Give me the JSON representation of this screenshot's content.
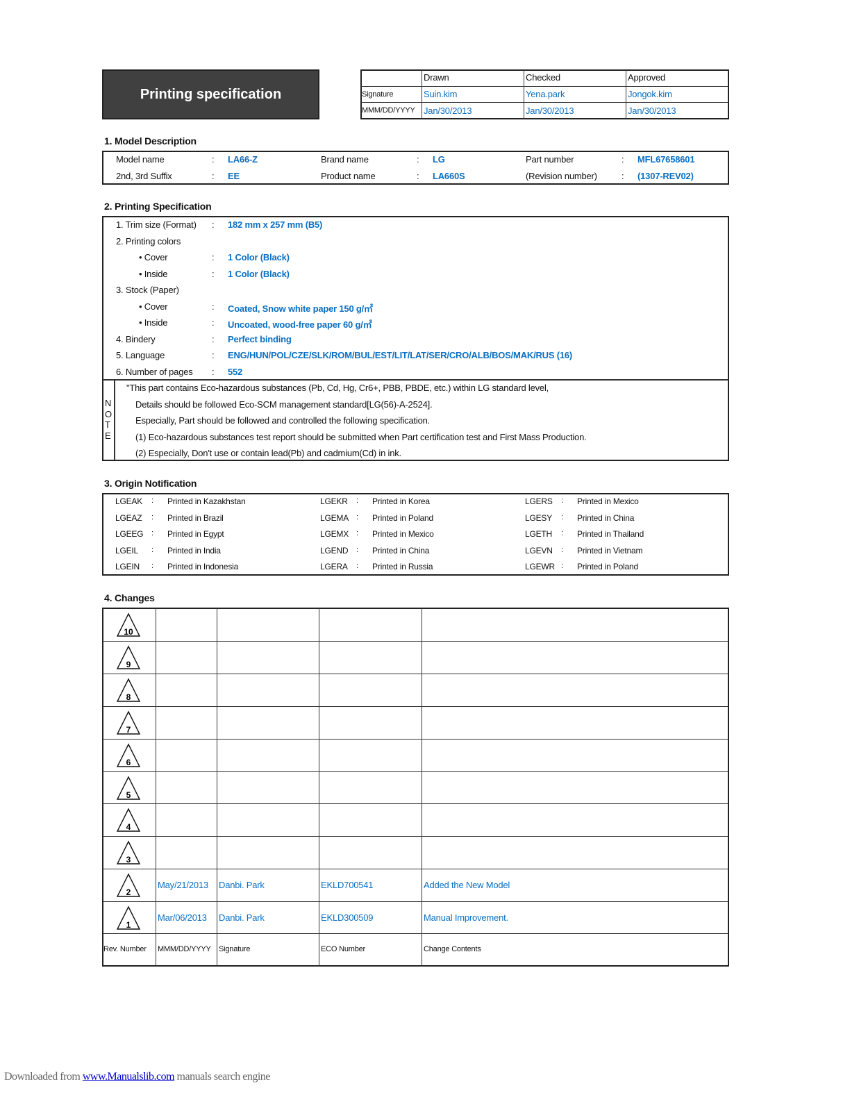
{
  "title": "Printing specification",
  "approval": {
    "headers": [
      "Drawn",
      "Checked",
      "Approved"
    ],
    "row_labels": [
      "Signature",
      "MMM/DD/YYYY"
    ],
    "signatures": [
      "Suin.kim",
      "Yena.park",
      "Jongok.kim"
    ],
    "dates": [
      "Jan/30/2013",
      "Jan/30/2013",
      "Jan/30/2013"
    ]
  },
  "model": {
    "heading": "1. Model Description",
    "colon": ":",
    "fields": [
      {
        "label": "Model name",
        "value": "LA66-Z"
      },
      {
        "label": "Brand name",
        "value": "LG"
      },
      {
        "label": "Part number",
        "value": "MFL67658601"
      },
      {
        "label": "2nd, 3rd Suffix",
        "value": "EE"
      },
      {
        "label": "Product name",
        "value": "LA660S"
      },
      {
        "label": "(Revision number)",
        "value": "(1307-REV02)"
      }
    ]
  },
  "spec": {
    "heading": "2. Printing Specification",
    "items": [
      {
        "label": "1. Trim size (Format)",
        "value": "182 mm x 257 mm (B5)",
        "indent": 0
      },
      {
        "label": "2. Printing colors",
        "value": "",
        "indent": 0
      },
      {
        "label": "• Cover",
        "value": "1 Color (Black)",
        "indent": 1
      },
      {
        "label": "• Inside",
        "value": "1 Color (Black)",
        "indent": 1
      },
      {
        "label": "3. Stock (Paper)",
        "value": "",
        "indent": 0
      },
      {
        "label": "• Cover",
        "value": "Coated, Snow white paper 150 g/㎡",
        "indent": 1
      },
      {
        "label": "• Inside",
        "value": "Uncoated, wood-free paper 60 g/㎡",
        "indent": 1
      },
      {
        "label": "4. Bindery",
        "value": "Perfect binding",
        "indent": 0
      },
      {
        "label": "5. Language",
        "value": "ENG/HUN/POL/CZE/SLK/ROM/BUL/EST/LIT/LAT/SER/CRO/ALB/BOS/MAK/RUS (16)",
        "indent": 0
      },
      {
        "label": "6. Number of pages",
        "value": "552",
        "indent": 0
      }
    ],
    "note_label": [
      "N",
      "O",
      "T",
      "E"
    ],
    "note_lines": [
      "\"This part contains Eco-hazardous substances (Pb, Cd, Hg, Cr6+, PBB, PBDE, etc.) within LG standard level,",
      "Details should be followed Eco-SCM management standard[LG(56)-A-2524].",
      "Especially, Part should be followed and controlled the following specification.",
      "(1) Eco-hazardous substances test report should be submitted when Part certification test and First Mass Production.",
      "(2) Especially, Don't use or contain lead(Pb) and cadmium(Cd) in ink."
    ]
  },
  "origin": {
    "heading": "3. Origin Notification",
    "columns": [
      [
        [
          "LGEAK",
          "Printed in Kazakhstan"
        ],
        [
          "LGEAZ",
          "Printed in Brazil"
        ],
        [
          "LGEEG",
          "Printed in Egypt"
        ],
        [
          "LGEIL",
          "Printed in India"
        ],
        [
          "LGEIN",
          "Printed in Indonesia"
        ]
      ],
      [
        [
          "LGEKR",
          "Printed in Korea"
        ],
        [
          "LGEMA",
          "Printed in Poland"
        ],
        [
          "LGEMX",
          "Printed in Mexico"
        ],
        [
          "LGEND",
          "Printed in China"
        ],
        [
          "LGERA",
          "Printed in Russia"
        ]
      ],
      [
        [
          "LGERS",
          "Printed in Mexico"
        ],
        [
          "LGESY",
          "Printed in China"
        ],
        [
          "LGETH",
          "Printed in Thailand"
        ],
        [
          "LGEVN",
          "Printed in Vietnam"
        ],
        [
          "LGEWR",
          "Printed in Poland"
        ]
      ]
    ]
  },
  "changes": {
    "heading": "4. Changes",
    "rows": [
      {
        "rev": "10",
        "date": "",
        "sig": "",
        "eco": "",
        "content": ""
      },
      {
        "rev": "9",
        "date": "",
        "sig": "",
        "eco": "",
        "content": ""
      },
      {
        "rev": "8",
        "date": "",
        "sig": "",
        "eco": "",
        "content": ""
      },
      {
        "rev": "7",
        "date": "",
        "sig": "",
        "eco": "",
        "content": ""
      },
      {
        "rev": "6",
        "date": "",
        "sig": "",
        "eco": "",
        "content": ""
      },
      {
        "rev": "5",
        "date": "",
        "sig": "",
        "eco": "",
        "content": ""
      },
      {
        "rev": "4",
        "date": "",
        "sig": "",
        "eco": "",
        "content": ""
      },
      {
        "rev": "3",
        "date": "",
        "sig": "",
        "eco": "",
        "content": ""
      },
      {
        "rev": "2",
        "date": "May/21/2013",
        "sig": "Danbi. Park",
        "eco": "EKLD700541",
        "content": "Added the New Model"
      },
      {
        "rev": "1",
        "date": "Mar/06/2013",
        "sig": "Danbi. Park",
        "eco": "EKLD300509",
        "content": "Manual Improvement."
      }
    ],
    "footer": [
      "Rev. Number",
      "MMM/DD/YYYY",
      "Signature",
      "ECO Number",
      "Change Contents"
    ]
  },
  "watermark": {
    "prefix": "Downloaded from ",
    "link": "www.Manualslib.com",
    "suffix": " manuals search engine"
  }
}
